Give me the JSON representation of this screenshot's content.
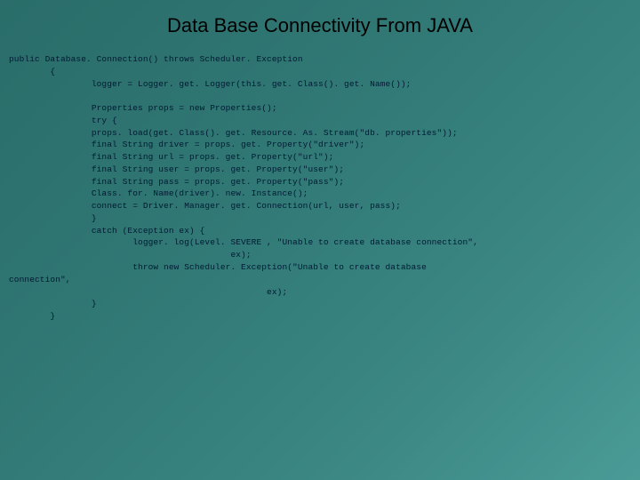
{
  "title": "Data Base Connectivity From JAVA",
  "code": {
    "l01": "public Database. Connection() throws Scheduler. Exception",
    "l02": "        {",
    "l03": "                logger = Logger. get. Logger(this. get. Class(). get. Name());",
    "l04": "",
    "l05": "                Properties props = new Properties();",
    "l06": "                try {",
    "l07": "                props. load(get. Class(). get. Resource. As. Stream(\"db. properties\"));",
    "l08": "                final String driver = props. get. Property(\"driver\");",
    "l09": "                final String url = props. get. Property(\"url\");",
    "l10": "                final String user = props. get. Property(\"user\");",
    "l11": "                final String pass = props. get. Property(\"pass\");",
    "l12": "                Class. for. Name(driver). new. Instance();",
    "l13": "                connect = Driver. Manager. get. Connection(url, user, pass);",
    "l14": "                }",
    "l15": "                catch (Exception ex) {",
    "l16": "                        logger. log(Level. SEVERE , \"Unable to create database connection\",",
    "l17": "                                           ex);",
    "l18": "                        throw new Scheduler. Exception(\"Unable to create database",
    "l19": "connection\",",
    "l20": "                                                  ex);",
    "l21": "                }",
    "l22": "        }"
  }
}
